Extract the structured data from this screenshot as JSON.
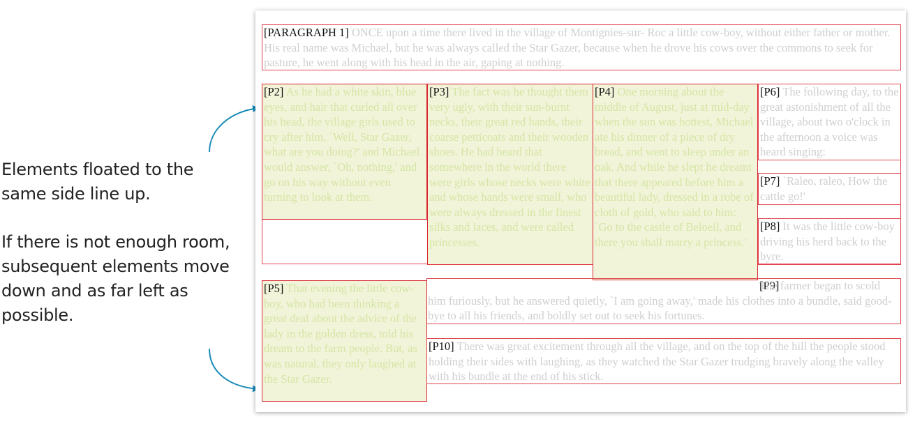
{
  "annotations": {
    "line_up": "Elements floated to the same side line up.",
    "move_down": "If there is not enough room, subsequent elements move down and as far left as possible."
  },
  "colors": {
    "float_fill": "#f1f4d8",
    "box_border": "#e0454f",
    "arrow": "#1a8cb8",
    "float_text": "#d6e4a6",
    "plain_text": "#cfcfcf"
  },
  "paragraphs": {
    "p1": {
      "tag": "[PARAGRAPH 1]",
      "text": " ONCE upon a time there lived in the village of Montignies-sur- Roc a little cow-boy, without either father or mother. His real name was Michael, but he was always called the Star Gazer, because when he drove his cows over the commons to seek for pasture, he went along with his head in the air, gaping at nothing."
    },
    "p2": {
      "tag": "[P2]",
      "text": " As he had a white skin, blue eyes, and hair that curled all over his head, the village girls used to cry after him, `Well, Star Gazer, what are you doing?' and Michael would answer, `Oh, nothing,' and go on his way without even turning to look at them."
    },
    "p3": {
      "tag": "[P3]",
      "text": " The fact was he thought them very ugly, with their sun-burnt necks, their great red hands, their coarse petticoats and their wooden shoes. He had heard that somewhere in the world there were girls whose necks were white and whose hands were small, who were always dressed in the finest silks and laces, and were called princesses."
    },
    "p4": {
      "tag": "[P4]",
      "text": " One morning about the middle of August, just at mid-day when the sun was hottest, Michael ate his dinner of a piece of dry bread, and went to sleep under an oak. And while he slept he dreamt that there appeared before him a beautiful lady, dressed in a robe of cloth of gold, who said to him: `Go to the castle of Beloeil, and there you shall marry a princess.'"
    },
    "p5": {
      "tag": "[P5]",
      "text": " That evening the little cow-boy, who had been thinking a great deal about the advice of the lady in the golden dress, told his dream to the farm people. But, as was natural, they only laughed at the Star Gazer."
    },
    "p6": {
      "tag": "[P6]",
      "text": " The following day, to the great astonishment of all the village, about two o'clock in the afternoon a voice was heard singing:"
    },
    "p7": {
      "tag": "[P7]",
      "text": " `Raleo, raleo, How the cattle go!'"
    },
    "p8": {
      "tag": "[P8]",
      "text": " It was the little cow-boy driving his herd back to the byre."
    },
    "p9": {
      "tag": "[P9]",
      "text": " The farmer began to scold him furiously, but he answered quietly, `I am going away,' made his clothes into a bundle, said good-bye to all his friends, and boldly set out to seek his fortunes."
    },
    "p10": {
      "tag": "[P10]",
      "text": " There was great excitement through all the village, and on the top of the hill the people stood holding their sides with laughing, as they watched the Star Gazer trudging bravely along the valley with his bundle at the end of his stick."
    }
  }
}
